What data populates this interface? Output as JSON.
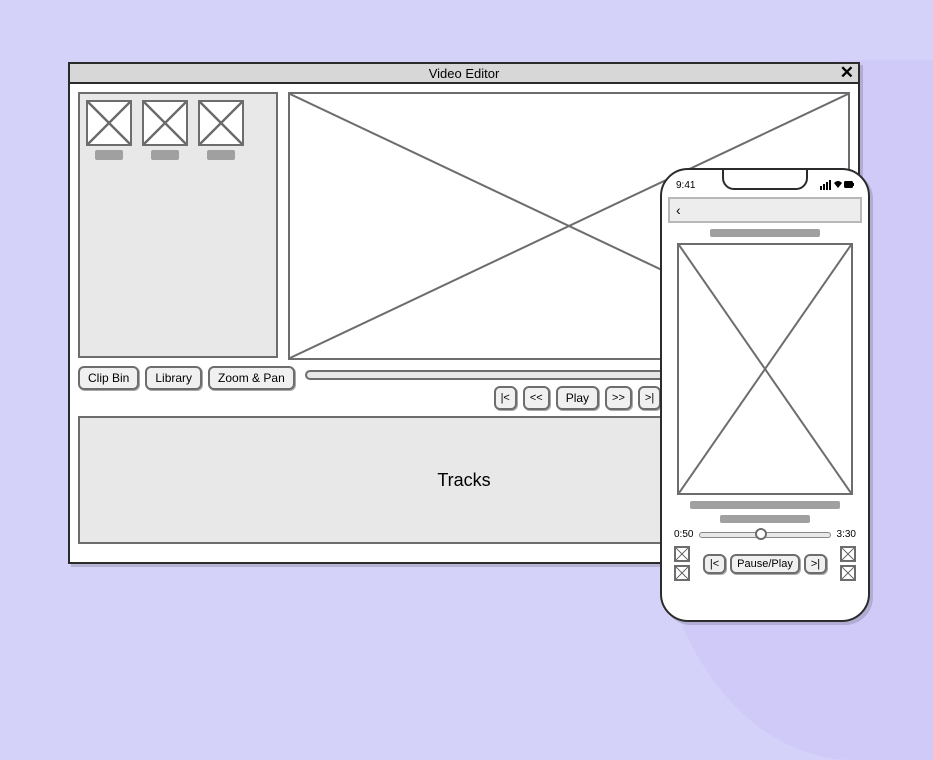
{
  "window": {
    "title": "Video Editor",
    "close_symbol": "✕",
    "tabs": {
      "clip_bin": "Clip Bin",
      "library": "Library",
      "zoom_pan": "Zoom & Pan"
    },
    "transport": {
      "start": "|<",
      "rewind": "<<",
      "play": "Play",
      "forward": ">>",
      "end": ">|"
    },
    "tracks_label": "Tracks"
  },
  "phone": {
    "time": "9:41",
    "back": "‹",
    "slider": {
      "start": "0:50",
      "end": "3:30"
    },
    "transport": {
      "prev": "|<",
      "pauseplay": "Pause/Play",
      "next": ">|"
    }
  }
}
